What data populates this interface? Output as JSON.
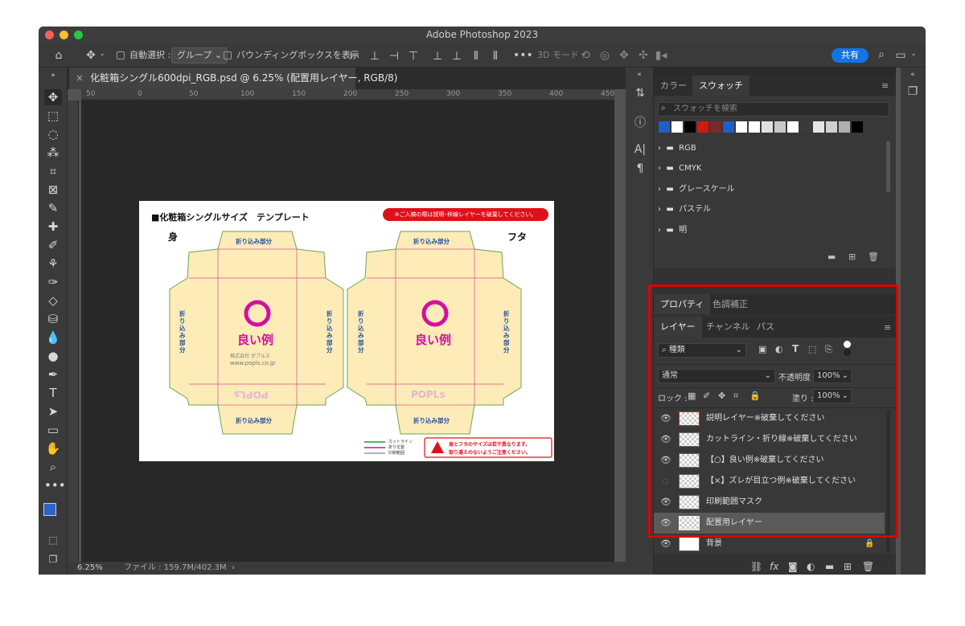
{
  "app": {
    "title": "Adobe Photoshop 2023"
  },
  "options": {
    "auto_select": "自動選択 :",
    "group": "グループ",
    "bounding_box": "バウンディングボックスを表示",
    "mode3d": "3D モード :",
    "share": "共有"
  },
  "document": {
    "tab_title": "化粧箱シングル600dpi_RGB.psd @ 6.25% (配置用レイヤー, RGB/8)",
    "zoom": "6.25%",
    "file_info": "ファイル : 159.7M/402.3M",
    "ruler": [
      "50",
      "0",
      "50",
      "100",
      "150",
      "200",
      "250",
      "300",
      "350",
      "400",
      "450"
    ]
  },
  "artwork": {
    "title": "■化粧箱シングルサイズ　テンプレート",
    "banner": "※ご入稿の際は説明･枠線レイヤーを破棄してください。",
    "body_label": "身",
    "lid_label": "フタ",
    "fold": "折り込み部分",
    "good_example": "良い例",
    "brand": "POPLs",
    "url": "www.popls.co.jp",
    "company": "株式会社 ポプルス",
    "legend": [
      "カットライン",
      "折り位置",
      "印刷範囲"
    ],
    "warning_1": "身とフタのサイズは若干異なります。",
    "warning_2": "取り違えのないようご注意ください。"
  },
  "swatches_panel": {
    "tabs": [
      "カラー",
      "スウォッチ"
    ],
    "search_placeholder": "スウォッチを検索",
    "colors": [
      "#1f5fc9",
      "#ffffff",
      "#000000",
      "#d4180f",
      "#7a2a2a",
      "#1f5fc9",
      "#ffffff",
      "#ffffff",
      "#e0e0e0",
      "#c8c8c8",
      "#ffffff",
      "#3a3a3a",
      "#e6e6e6",
      "#d0d0d0",
      "#b0b0b0",
      "#000000"
    ],
    "folders": [
      "RGB",
      "CMYK",
      "グレースケール",
      "パステル",
      "明"
    ]
  },
  "props_panel": {
    "tabs": [
      "プロパティ",
      "色調補正"
    ]
  },
  "layers_panel": {
    "tabs": [
      "レイヤー",
      "チャンネル",
      "パス"
    ],
    "kind": "種類",
    "blend_mode": "通常",
    "opacity_label": "不透明度 :",
    "opacity": "100%",
    "lock_label": "ロック :",
    "fill_label": "塗り :",
    "fill": "100%",
    "layers": [
      {
        "name": "説明レイヤー※破棄してください",
        "visible": true,
        "selected": false,
        "locked": false
      },
      {
        "name": "カットライン・折り線※破棄してください",
        "visible": true,
        "selected": false,
        "locked": false
      },
      {
        "name": "【○】良い例※破棄してください",
        "visible": true,
        "selected": false,
        "locked": false
      },
      {
        "name": "【×】ズレが目立つ例※破棄してください",
        "visible": false,
        "selected": false,
        "locked": false
      },
      {
        "name": "印刷範囲マスク",
        "visible": true,
        "selected": false,
        "locked": false
      },
      {
        "name": "配置用レイヤー",
        "visible": true,
        "selected": true,
        "locked": false
      },
      {
        "name": "背景",
        "visible": true,
        "selected": false,
        "locked": true
      }
    ]
  },
  "highlight_color": "#e00000"
}
